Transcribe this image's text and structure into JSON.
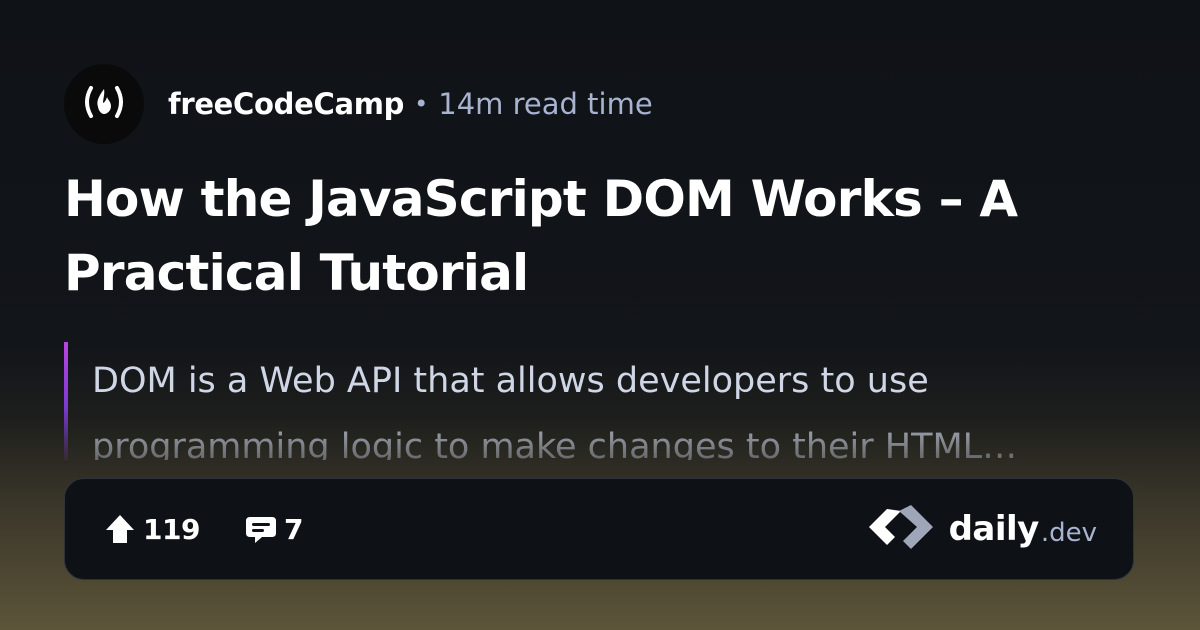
{
  "source": {
    "name": "freeCodeCamp",
    "separator": "•",
    "read_time": "14m read time",
    "avatar_icon": "freecodecamp-flame-icon"
  },
  "post": {
    "title": "How the JavaScript DOM Works – A Practical Tutorial",
    "summary_line_1": "DOM is a Web API that allows developers to use",
    "summary_line_2": "programming logic to make changes to their HTML…"
  },
  "stats": {
    "upvotes": "119",
    "upvote_icon": "arrow-up-icon",
    "comments": "7",
    "comment_icon": "comment-icon"
  },
  "brand": {
    "logo_icon": "daily-dev-logo-icon",
    "name": "daily",
    "suffix": ".dev"
  },
  "colors": {
    "accent_bar": "#b846e0",
    "muted_text": "#a8b3cf",
    "card_bg": "#0e1217"
  }
}
